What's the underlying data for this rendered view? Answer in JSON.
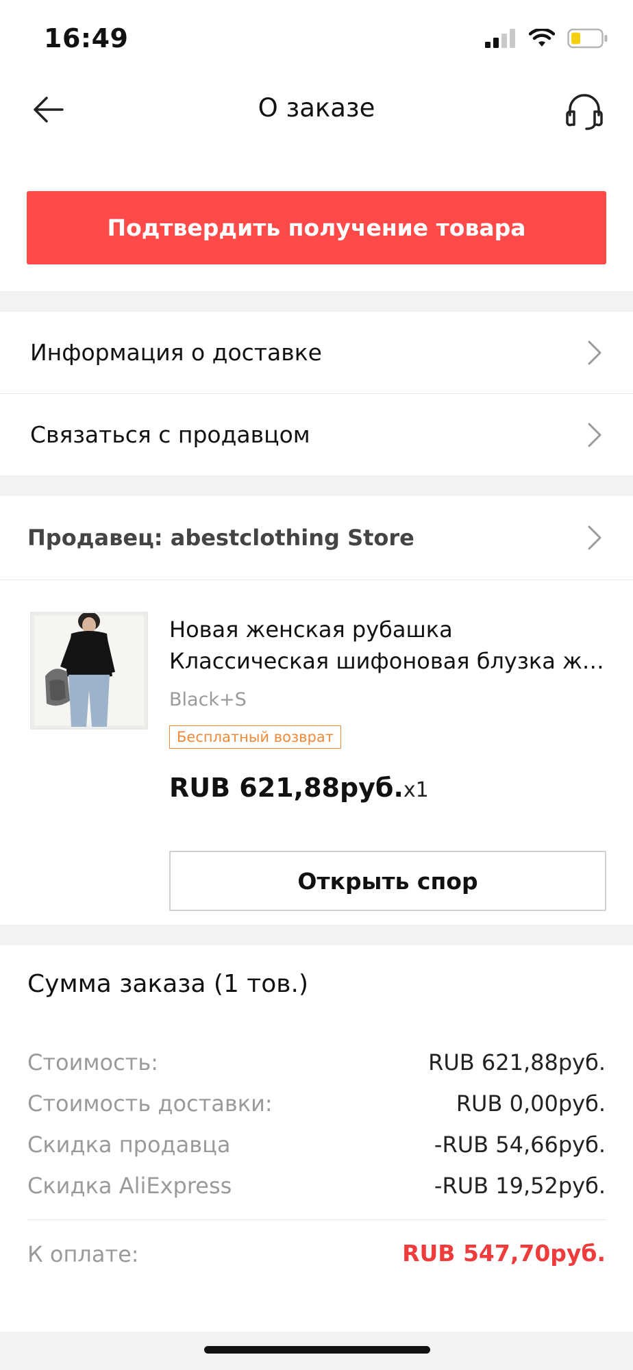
{
  "status_bar": {
    "time": "16:49"
  },
  "header": {
    "title": "О заказе"
  },
  "confirm_button": {
    "label": "Подтвердить получение товара"
  },
  "menu": {
    "delivery_info": "Информация о доставке",
    "contact_seller": "Связаться с продавцом"
  },
  "seller": {
    "label": "Продавец: abestclothing Store"
  },
  "product": {
    "title_line1": "Новая женская рубашка",
    "title_line2": "Классическая шифоновая блузка же...",
    "variant": "Black+S",
    "badge": "Бесплатный возврат",
    "price": "RUB 621,88руб.",
    "quantity": "x1",
    "dispute_button": "Открыть спор"
  },
  "summary": {
    "title": "Сумма заказа (1 тов.)",
    "rows": [
      {
        "label": "Стоимость:",
        "value": "RUB 621,88руб."
      },
      {
        "label": "Стоимость доставки:",
        "value": "RUB 0,00руб."
      },
      {
        "label": "Скидка продавца",
        "value": "-RUB 54,66руб."
      },
      {
        "label": "Скидка AliExpress",
        "value": "-RUB 19,52руб."
      }
    ],
    "total_label": "К оплате:",
    "total_value": "RUB 547,70руб."
  },
  "colors": {
    "accent": "#ff4a4a",
    "total": "#ee3b3b",
    "badge": "#f08a3a",
    "section_gap": "#f2f2f2"
  },
  "icons": [
    "back-arrow-icon",
    "headset-icon",
    "chevron-right-icon",
    "signal-icon",
    "wifi-icon",
    "battery-icon"
  ]
}
